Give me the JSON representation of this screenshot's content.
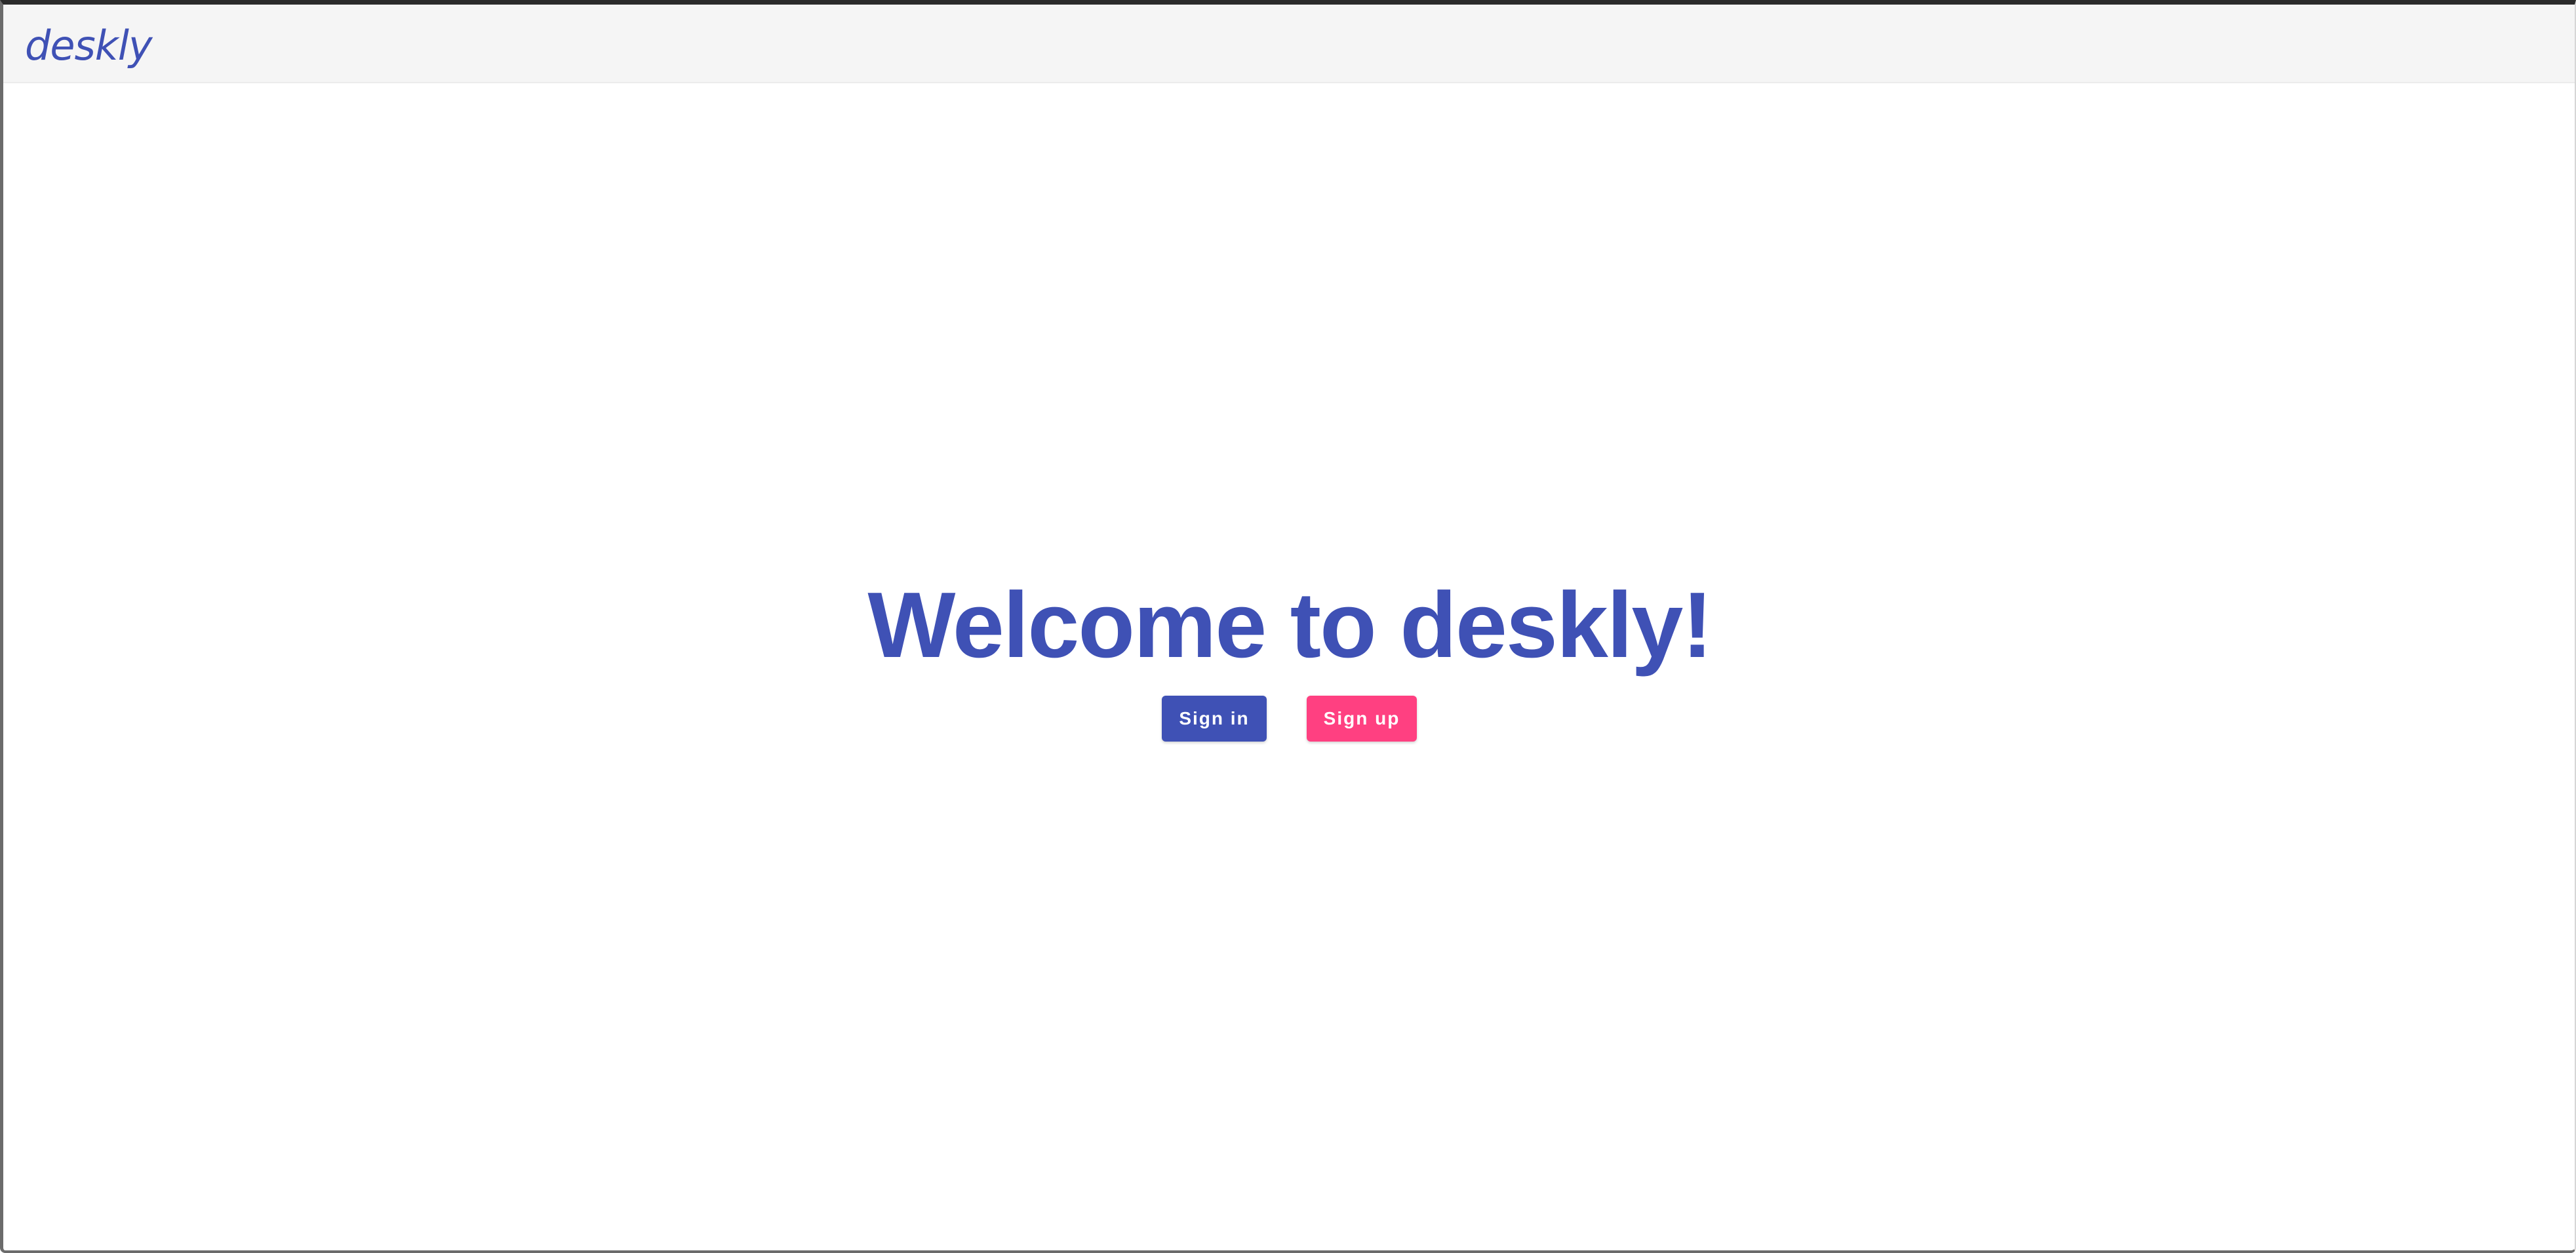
{
  "app": {
    "brand": "deskly"
  },
  "hero": {
    "title": "Welcome to deskly!"
  },
  "actions": {
    "sign_in_label": "Sign in",
    "sign_up_label": "Sign up"
  },
  "colors": {
    "primary": "#3f51b5",
    "accent": "#ff4081",
    "toolbar_bg": "#f5f5f5",
    "page_bg": "#ffffff"
  }
}
